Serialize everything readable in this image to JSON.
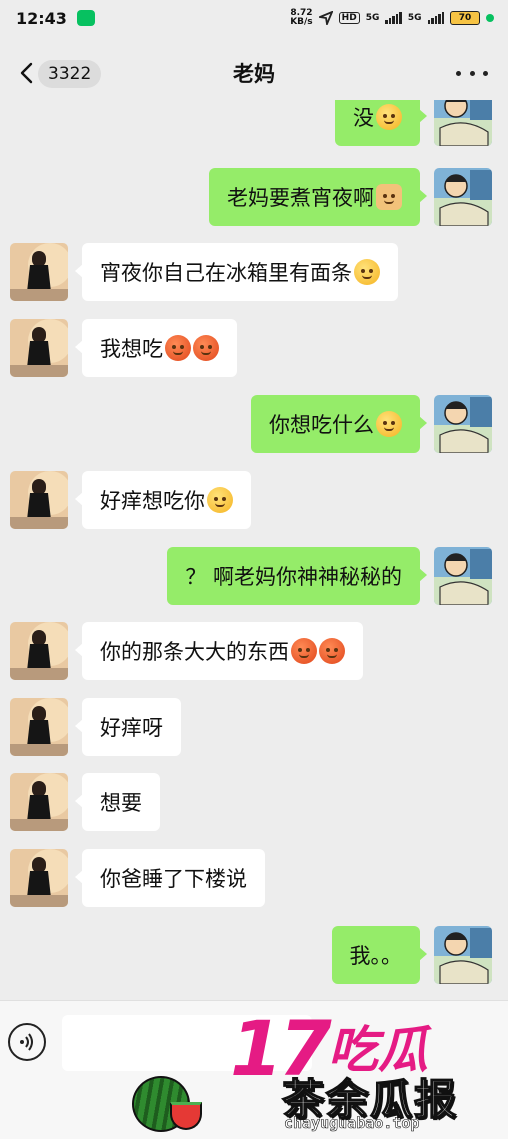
{
  "status_bar": {
    "time": "12:43",
    "speed_value": "8.72",
    "speed_unit": "KB/s",
    "hd": "HD",
    "signal_1": "5G",
    "signal_2": "5G",
    "battery": "70"
  },
  "header": {
    "unread_count": "3322",
    "title": "老妈"
  },
  "messages": [
    {
      "side": "out",
      "text": "没",
      "emoji": "yellow"
    },
    {
      "side": "out",
      "text": "老妈要煮宵夜啊",
      "emoji": "dog"
    },
    {
      "side": "in",
      "text": "宵夜你自己在冰箱里有面条",
      "emoji": "yellow"
    },
    {
      "side": "in",
      "text": "我想吃",
      "emoji": "red"
    },
    {
      "side": "out",
      "text": "你想吃什么",
      "emoji": "yellow"
    },
    {
      "side": "in",
      "text": "好痒想吃你",
      "emoji": "yellow"
    },
    {
      "side": "out",
      "text": "？ 啊老妈你神神秘秘的",
      "emoji": ""
    },
    {
      "side": "in",
      "text": "你的那条大大的东西",
      "emoji": "red"
    },
    {
      "side": "in",
      "text": "好痒呀",
      "emoji": ""
    },
    {
      "side": "in",
      "text": "想要",
      "emoji": ""
    },
    {
      "side": "in",
      "text": "你爸睡了下楼说",
      "emoji": ""
    },
    {
      "side": "out",
      "text": "我。。",
      "emoji": ""
    }
  ],
  "watermark": {
    "number": "17",
    "top_text": "吃瓜",
    "bottom_text": "茶余瓜报",
    "domain": "chayuguabao.top"
  },
  "colors": {
    "outgoing_bubble": "#95ec69",
    "incoming_bubble": "#ffffff",
    "background": "#ededed",
    "watermark": "#e51b84"
  }
}
